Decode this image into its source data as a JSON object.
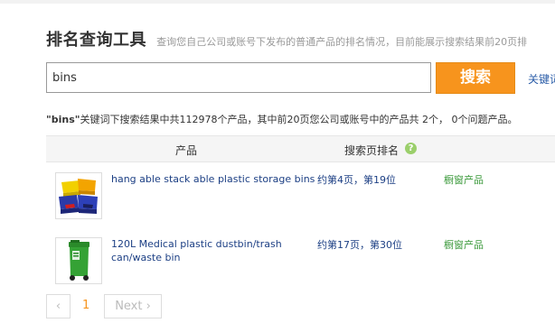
{
  "header": {
    "title": "排名查询工具",
    "subtitle": "查询您自己公司或账号下发布的普通产品的排名情况，目前能展示搜索结果前20页排"
  },
  "search": {
    "value": "bins",
    "button_label": "搜索",
    "keyword_link": "关键词"
  },
  "summary": {
    "keyword": "\"bins\"",
    "text_before": "关键词下搜索结果中共",
    "total": "112978",
    "text_middle": "个产品，其中前20页您公司或账号中的产品共",
    "count": "2个",
    "text_after": "，",
    "issues": "0个问题产品。"
  },
  "table": {
    "col_product": "产品",
    "col_rank": "搜索页排名",
    "help_icon": "?",
    "rows": [
      {
        "name": "hang able stack able plastic storage bins",
        "rank": "约第4页，第19位",
        "type": "橱窗产品",
        "thumb_icon": "storage-bins-image"
      },
      {
        "name": "120L Medical plastic dustbin/trash can/waste bin",
        "rank": "约第17页，第30位",
        "type": "橱窗产品",
        "thumb_icon": "trash-can-image"
      }
    ]
  },
  "pagination": {
    "prev_symbol": "‹",
    "current_page": "1",
    "next_label": "Next ›"
  },
  "colors": {
    "accent": "#f7941d",
    "link": "#1c3f84",
    "showcase": "#3c9a3c"
  }
}
